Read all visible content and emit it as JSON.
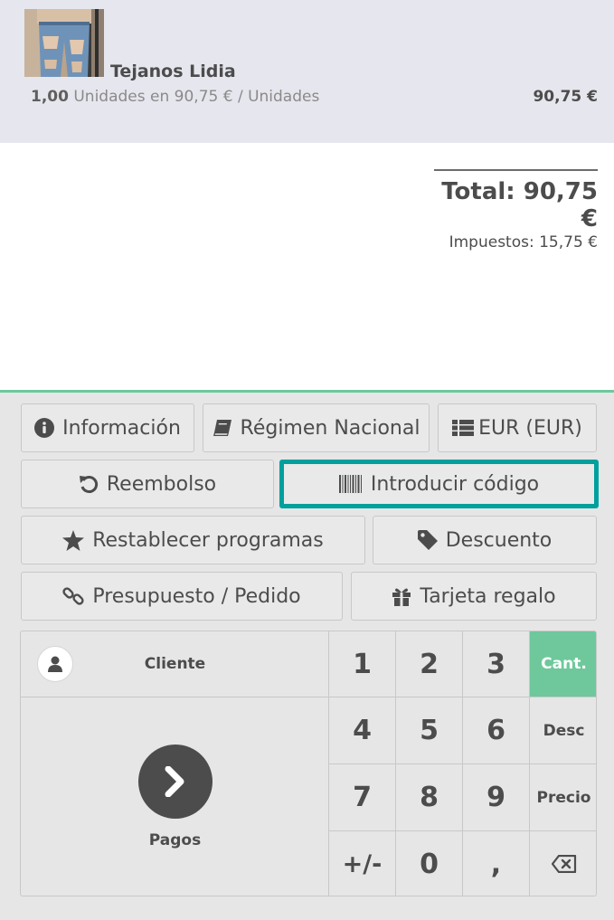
{
  "orderline": {
    "product_name": "Tejanos Lidia",
    "quantity": "1,00",
    "unit_info": "Unidades en 90,75 € / Unidades",
    "price": "90,75 €"
  },
  "totals": {
    "total": "Total: 90,75 €",
    "taxes": "Impuestos: 15,75 €"
  },
  "control_buttons": {
    "info": "Información",
    "fiscal": "Régimen Nacional",
    "currency": "EUR (EUR)",
    "refund": "Reembolso",
    "enter_code": "Introducir código",
    "reset_programs": "Restablecer programas",
    "discount": "Descuento",
    "quotation": "Presupuesto / Pedido",
    "gift_card": "Tarjeta regalo"
  },
  "customer": {
    "label": "Cliente"
  },
  "payment": {
    "label": "Pagos"
  },
  "numpad": {
    "k1": "1",
    "k2": "2",
    "k3": "3",
    "k4": "4",
    "k5": "5",
    "k6": "6",
    "k7": "7",
    "k8": "8",
    "k9": "9",
    "sign": "+/-",
    "k0": "0",
    "decimal": ","
  },
  "modes": {
    "quantity": "Cant.",
    "discount": "Desc",
    "price": "Precio"
  },
  "colors": {
    "accent": "#6ec89b",
    "highlight_border": "#00a09d",
    "orderline_bg": "#e6e6ee"
  },
  "icons": {
    "info": "info-circle-icon",
    "fiscal": "book-icon",
    "currency": "list-icon",
    "refund": "undo-icon",
    "enter_code": "barcode-icon",
    "reset_programs": "star-icon",
    "discount": "tag-icon",
    "quotation": "link-icon",
    "gift_card": "gift-icon",
    "customer": "user-icon",
    "payment": "chevron-right-icon",
    "backspace": "backspace-icon"
  }
}
